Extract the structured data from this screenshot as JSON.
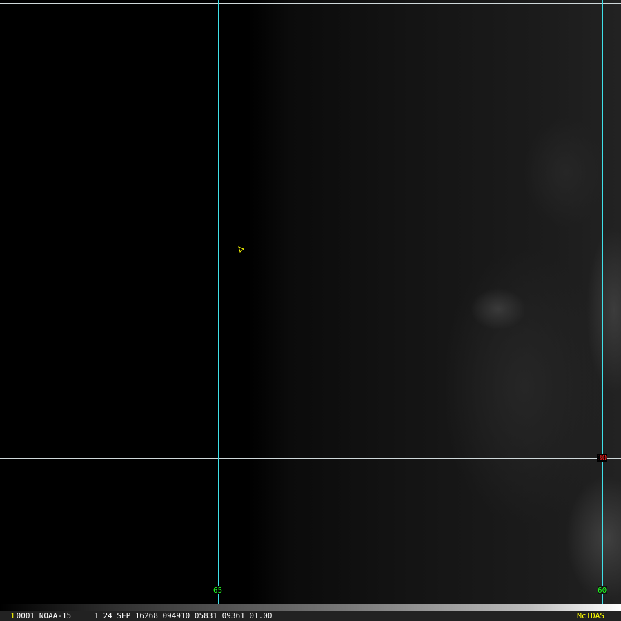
{
  "grid": {
    "lat_labels": [
      {
        "text": "30",
        "color": "#ff2020"
      }
    ],
    "lon_labels": [
      {
        "text": "65",
        "color": "#20ff20"
      },
      {
        "text": "60",
        "color": "#20ff20"
      }
    ],
    "line_color": "#3fe0e8"
  },
  "status_bar": {
    "frame_number": "1",
    "info": "0001 NOAA-15     1 24 SEP 16268 094910 05831 09361 01.00",
    "brand": "McIDAS"
  },
  "marker": {
    "icon": "storm-position-triangle-icon",
    "color": "#ffff00"
  }
}
